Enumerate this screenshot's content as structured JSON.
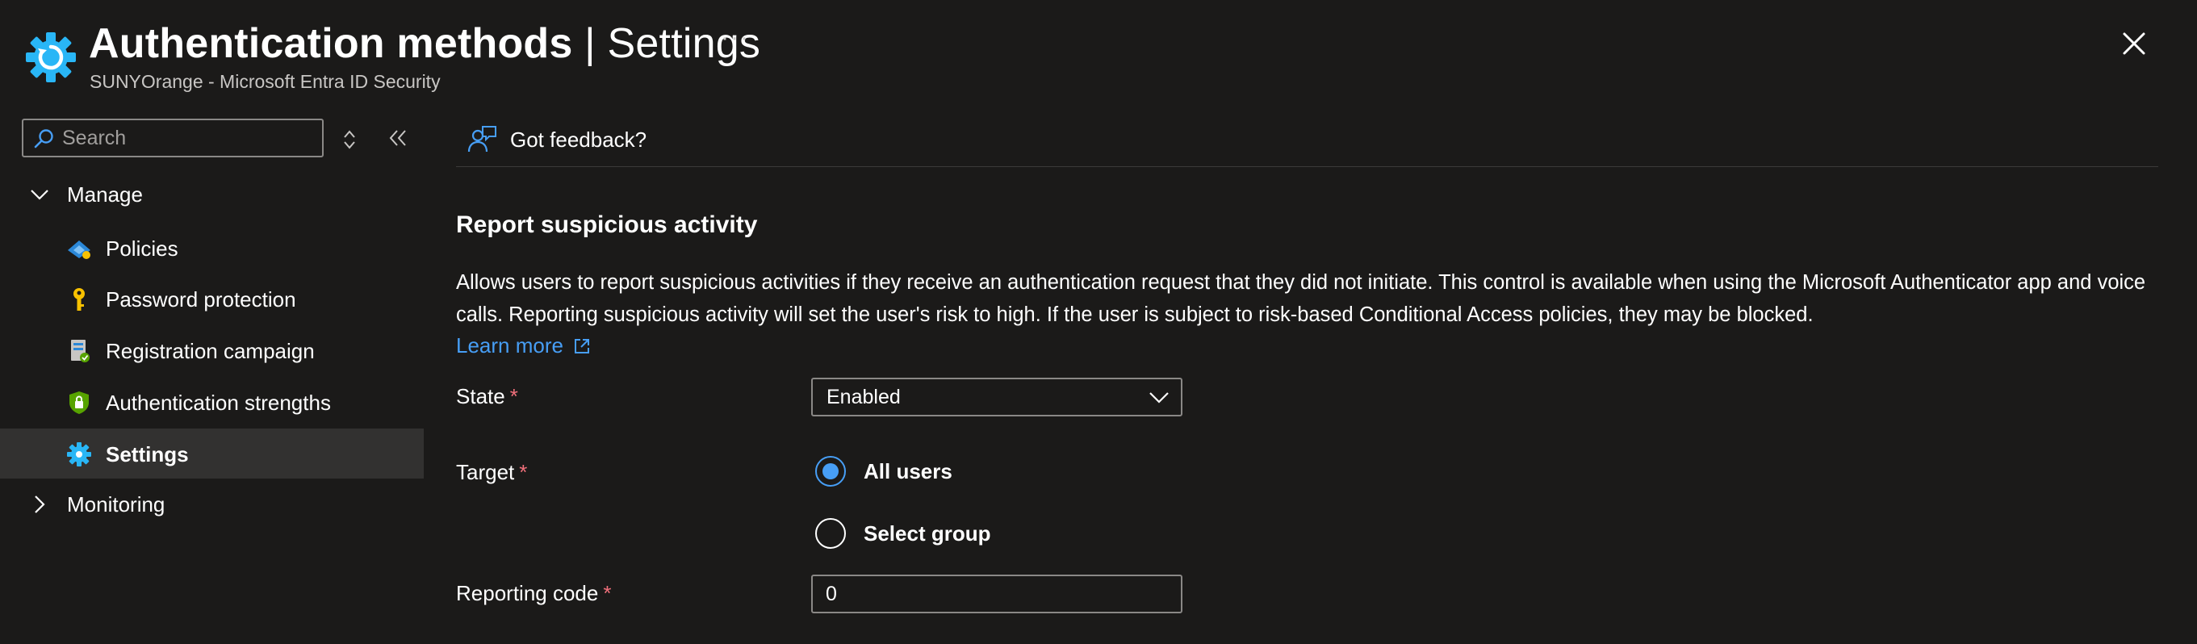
{
  "header": {
    "title_main": "Authentication methods",
    "title_separator": "|",
    "title_sub": "Settings",
    "subtitle": "SUNYOrange - Microsoft Entra ID Security",
    "more_label": "···",
    "accent_color": "#29b6f6"
  },
  "sidebar": {
    "search": {
      "placeholder": "Search",
      "value": ""
    },
    "groups": [
      {
        "label": "Manage",
        "expanded": true,
        "icon": "chevron-down-icon"
      },
      {
        "label": "Monitoring",
        "expanded": false,
        "icon": "chevron-right-icon"
      }
    ],
    "items": [
      {
        "label": "Policies",
        "icon": "policies-icon",
        "selected": false
      },
      {
        "label": "Password protection",
        "icon": "key-icon",
        "selected": false
      },
      {
        "label": "Registration campaign",
        "icon": "registration-campaign-icon",
        "selected": false
      },
      {
        "label": "Authentication strengths",
        "icon": "shield-lock-icon",
        "selected": false
      },
      {
        "label": "Settings",
        "icon": "gear-icon",
        "selected": true
      }
    ]
  },
  "main": {
    "feedback_label": "Got feedback?",
    "section_title": "Report suspicious activity",
    "description": "Allows users to report suspicious activities if they receive an authentication request that they did not initiate. This control is available when using the Microsoft Authenticator app and voice calls. Reporting suspicious activity will set the user's risk to high. If the user is subject to risk-based Conditional Access policies, they may be blocked.",
    "learn_more": "Learn more",
    "required_mark": "*",
    "state": {
      "label": "State",
      "value": "Enabled"
    },
    "target": {
      "label": "Target",
      "options": [
        {
          "label": "All users",
          "checked": true
        },
        {
          "label": "Select group",
          "checked": false
        }
      ]
    },
    "reporting_code": {
      "label": "Reporting code",
      "value": "0"
    }
  }
}
